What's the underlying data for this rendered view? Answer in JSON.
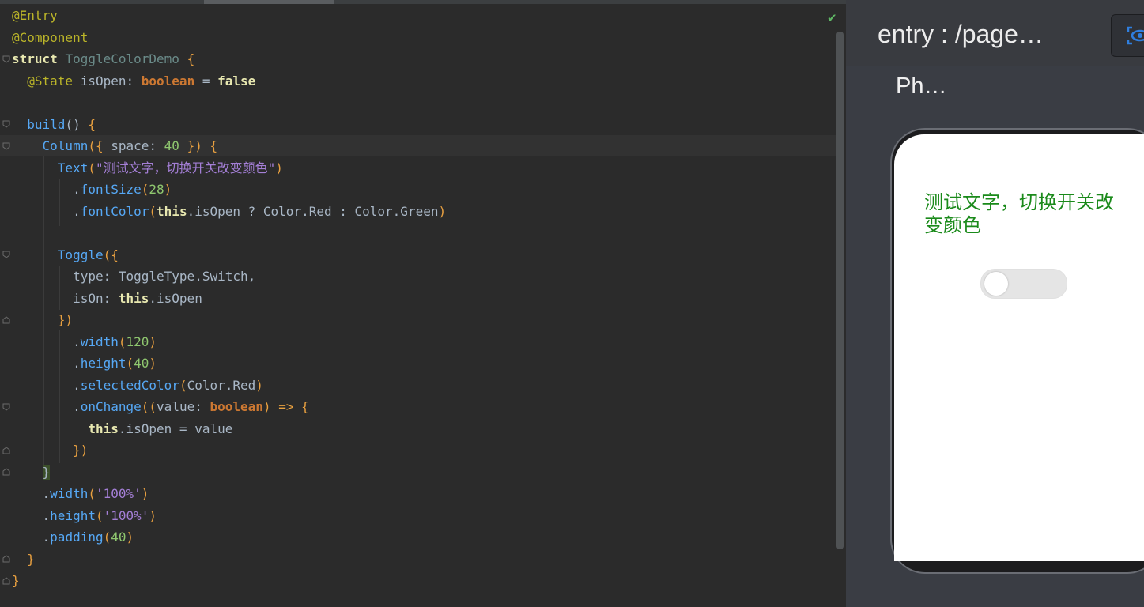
{
  "editor": {
    "status_check": "✔",
    "lines": [
      [
        [
          "ann",
          "@Entry"
        ]
      ],
      [
        [
          "ann",
          "@Component"
        ]
      ],
      [
        [
          "kw",
          "struct"
        ],
        [
          "idn",
          " "
        ],
        [
          "ty",
          "ToggleColorDemo"
        ],
        [
          "idn",
          " "
        ],
        [
          "pu",
          "{"
        ]
      ],
      [
        [
          "idn",
          "  "
        ],
        [
          "ann",
          "@State"
        ],
        [
          "idn",
          " isOpen: "
        ],
        [
          "k",
          "boolean"
        ],
        [
          "idn",
          " = "
        ],
        [
          "kw",
          "false"
        ]
      ],
      [
        [
          "idn",
          ""
        ]
      ],
      [
        [
          "idn",
          "  "
        ],
        [
          "fn",
          "build"
        ],
        [
          "idn",
          "() "
        ],
        [
          "pu",
          "{"
        ]
      ],
      [
        [
          "idn",
          "    "
        ],
        [
          "fn",
          "Column"
        ],
        [
          "pu",
          "("
        ],
        [
          "pu",
          "{"
        ],
        [
          "idn",
          " space: "
        ],
        [
          "num",
          "40"
        ],
        [
          "idn",
          " "
        ],
        [
          "pu",
          "}"
        ],
        [
          "pu",
          ")"
        ],
        [
          "idn",
          " "
        ],
        [
          "pu",
          "{"
        ]
      ],
      [
        [
          "idn",
          "      "
        ],
        [
          "fn",
          "Text"
        ],
        [
          "pu",
          "("
        ],
        [
          "str",
          "\"测试文字，切换开关改变颜色\""
        ],
        [
          "pu",
          ")"
        ]
      ],
      [
        [
          "idn",
          "        ."
        ],
        [
          "fn",
          "fontSize"
        ],
        [
          "pu",
          "("
        ],
        [
          "num",
          "28"
        ],
        [
          "pu",
          ")"
        ]
      ],
      [
        [
          "idn",
          "        ."
        ],
        [
          "fn",
          "fontColor"
        ],
        [
          "pu",
          "("
        ],
        [
          "kw",
          "this"
        ],
        [
          "idn",
          ".isOpen ? Color.Red : Color.Green"
        ],
        [
          "pu",
          ")"
        ]
      ],
      [
        [
          "idn",
          ""
        ]
      ],
      [
        [
          "idn",
          "      "
        ],
        [
          "fn",
          "Toggle"
        ],
        [
          "pu",
          "("
        ],
        [
          "pu",
          "{"
        ]
      ],
      [
        [
          "idn",
          "        type: ToggleType.Switch,"
        ]
      ],
      [
        [
          "idn",
          "        isOn: "
        ],
        [
          "kw",
          "this"
        ],
        [
          "idn",
          ".isOpen"
        ]
      ],
      [
        [
          "idn",
          "      "
        ],
        [
          "pu",
          "}"
        ],
        [
          "pu",
          ")"
        ]
      ],
      [
        [
          "idn",
          "        ."
        ],
        [
          "fn",
          "width"
        ],
        [
          "pu",
          "("
        ],
        [
          "num",
          "120"
        ],
        [
          "pu",
          ")"
        ]
      ],
      [
        [
          "idn",
          "        ."
        ],
        [
          "fn",
          "height"
        ],
        [
          "pu",
          "("
        ],
        [
          "num",
          "40"
        ],
        [
          "pu",
          ")"
        ]
      ],
      [
        [
          "idn",
          "        ."
        ],
        [
          "fn",
          "selectedColor"
        ],
        [
          "pu",
          "("
        ],
        [
          "idn",
          "Color.Red"
        ],
        [
          "pu",
          ")"
        ]
      ],
      [
        [
          "idn",
          "        ."
        ],
        [
          "fn",
          "onChange"
        ],
        [
          "pu",
          "("
        ],
        [
          "pu",
          "("
        ],
        [
          "idn",
          "value: "
        ],
        [
          "k",
          "boolean"
        ],
        [
          "pu",
          ")"
        ],
        [
          "idn",
          " "
        ],
        [
          "pu",
          "=>"
        ],
        [
          "idn",
          " "
        ],
        [
          "pu",
          "{"
        ]
      ],
      [
        [
          "idn",
          "          "
        ],
        [
          "kw",
          "this"
        ],
        [
          "idn",
          ".isOpen = value"
        ]
      ],
      [
        [
          "idn",
          "        "
        ],
        [
          "pu",
          "}"
        ],
        [
          "pu",
          ")"
        ]
      ],
      [
        [
          "idn",
          "    "
        ],
        [
          "hl",
          "}"
        ]
      ],
      [
        [
          "idn",
          "    ."
        ],
        [
          "fn",
          "width"
        ],
        [
          "pu",
          "("
        ],
        [
          "str",
          "'100%'"
        ],
        [
          "pu",
          ")"
        ]
      ],
      [
        [
          "idn",
          "    ."
        ],
        [
          "fn",
          "height"
        ],
        [
          "pu",
          "("
        ],
        [
          "str",
          "'100%'"
        ],
        [
          "pu",
          ")"
        ]
      ],
      [
        [
          "idn",
          "    ."
        ],
        [
          "fn",
          "padding"
        ],
        [
          "pu",
          "("
        ],
        [
          "num",
          "40"
        ],
        [
          "pu",
          ")"
        ]
      ],
      [
        [
          "idn",
          "  "
        ],
        [
          "pu",
          "}"
        ]
      ],
      [
        [
          "pu",
          "}"
        ]
      ]
    ]
  },
  "preview": {
    "title": "entry : /page…",
    "device_name": "Ph…",
    "inspect_icon": "eye-inspect-icon",
    "toolbar_icons": [
      "text-toggle-icon",
      "back-triangle-icon",
      "rotate-device-icon",
      "more-vertical-icon"
    ],
    "demo": {
      "text": "测试文字，切换开关改变颜色",
      "text_color": "#1a8a1a",
      "toggle_on": false
    }
  },
  "colors": {
    "keyword": "#cc7832",
    "annotation": "#bbb529",
    "function": "#56a8f5",
    "string": "#a47fd6",
    "number": "#8fc76f",
    "accent_blue": "#2f7fe0"
  }
}
